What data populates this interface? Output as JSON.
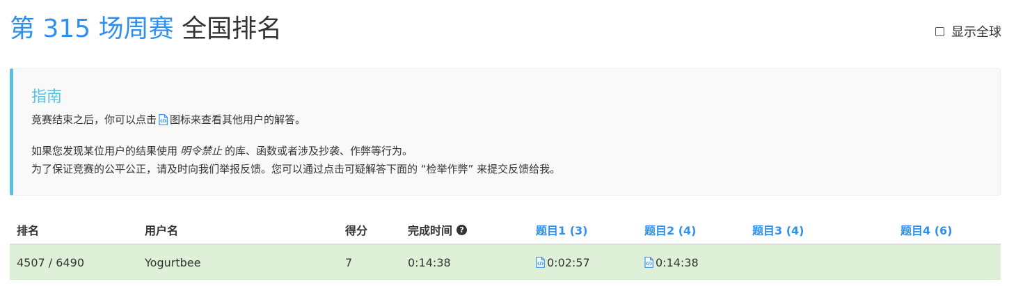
{
  "header": {
    "contest_name": "第 315 场周赛",
    "rank_word": "全国排名",
    "show_global_label": "显示全球",
    "show_global_checked": false
  },
  "guide": {
    "title": "指南",
    "line1_before": "竞赛结束之后，你可以点击",
    "line1_after": "图标来查看其他用户的解答。",
    "line2_before": "如果您发现某位用户的结果使用",
    "line2_em": "明令禁止",
    "line2_after": "的库、函数或者涉及抄袭、作弊等行为。",
    "line3": "为了保证竞赛的公平公正，请及时向我们举报反馈。您可以通过点击可疑解答下面的 “检举作弊” 来提交反馈给我。",
    "icon": "code-file-icon"
  },
  "table": {
    "headers": {
      "rank": "排名",
      "user": "用户名",
      "score": "得分",
      "finish_time": "完成时间",
      "q1": "题目1 (3)",
      "q2": "题目2 (4)",
      "q3": "题目3 (4)",
      "q4": "题目4 (6)"
    },
    "help_icon": "question-circle-icon",
    "rows": [
      {
        "rank": "4507 / 6490",
        "user": "Yogurtbee",
        "score": "7",
        "finish_time": "0:14:38",
        "q1": "0:02:57",
        "q2": "0:14:38",
        "q3": "",
        "q4": ""
      }
    ]
  },
  "colors": {
    "accent": "#2d8ff0",
    "guide_accent": "#5bc0de",
    "row_success": "#dff0d8"
  }
}
